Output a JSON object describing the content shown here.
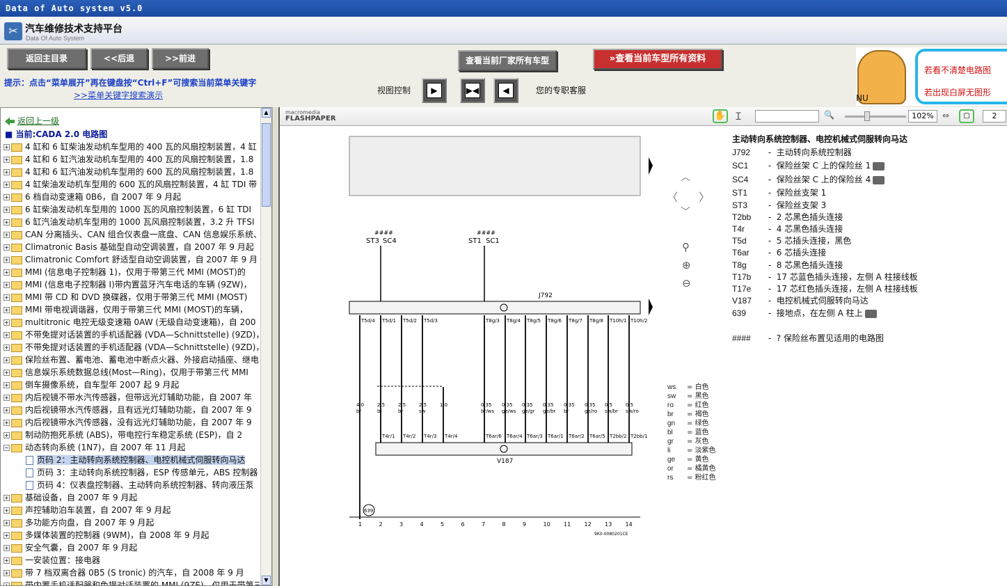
{
  "window": {
    "title": "Data of Auto system v5.0"
  },
  "app": {
    "title": "汽车维修技术支持平台",
    "subtitle": "Data Of Auto System"
  },
  "toolbar": {
    "home_label": "返回主目录",
    "back_label": "<<后退",
    "forward_label": ">>前进",
    "all_models_label": "查看当前厂家所有车型",
    "all_data_label": "查看当前车型所有资料",
    "tip": "提示：点击“菜单展开”再在键盘按“Ctrl+F”可搜索当前菜单关键字",
    "tip_link": ">>菜单关键字搜索演示",
    "view_control_label": "视图控制",
    "customer_service": "您的专职客服"
  },
  "ad": {
    "line1": "若看不清楚电路图",
    "line2": "若出现白屏无图形",
    "nu": "NU"
  },
  "tree": {
    "back_label": "返回上一级",
    "current_label": "当前:CADA 2.0 电路图",
    "items": [
      {
        "type": "folder",
        "label": "4 缸和 6 缸柴油发动机车型用的 400 瓦的风扇控制装置，4 缸"
      },
      {
        "type": "folder",
        "label": "4 缸和 6 缸汽油发动机车型用的 400 瓦的风扇控制装置，1.8"
      },
      {
        "type": "folder",
        "label": "4 缸和 6 缸汽油发动机车型用的 600 瓦的风扇控制装置，1.8"
      },
      {
        "type": "folder",
        "label": "4 缸柴油发动机车型用的 600 瓦的风扇控制装置，4 缸 TDI 带"
      },
      {
        "type": "folder",
        "label": "6 档自动变速箱 0B6，自 2007 年 9 月起"
      },
      {
        "type": "folder",
        "label": "6 缸柴油发动机车型用的 1000 瓦的风扇控制装置，6 缸 TDI"
      },
      {
        "type": "folder",
        "label": "6 缸汽油发动机车型用的 1000 瓦风扇控制装置，3.2 升 TFSI"
      },
      {
        "type": "folder",
        "label": "CAN 分离插头、CAN 组合仪表盘一底盘、CAN 信息娱乐系统、"
      },
      {
        "type": "folder",
        "label": "Climatronic Basis 基础型自动空调装置，自 2007 年 9 月起"
      },
      {
        "type": "folder",
        "label": "Climatronic Comfort 舒适型自动空调装置，自 2007 年 9 月"
      },
      {
        "type": "folder",
        "label": "MMI (信息电子控制器 1)，仅用于带第三代 MMI (MOST)的"
      },
      {
        "type": "folder",
        "label": "MMI (信息电子控制器 I)带内置蓝牙汽车电话的车辆 (9ZW)，"
      },
      {
        "type": "folder",
        "label": "MMI 带 CD 和 DVD 换碟器，仅用于带第三代 MMI (MOST)"
      },
      {
        "type": "folder",
        "label": "MMI 带电视调谐器，仅用于带第三代 MMI (MOST)的车辆，"
      },
      {
        "type": "folder",
        "label": "multitronic 电控无级变速箱 0AW (无级自动变速箱)，自 200"
      },
      {
        "type": "folder",
        "label": "不带免提对话装置的手机适配器 (VDA—Schnittstelle) (9ZD)，"
      },
      {
        "type": "folder",
        "label": "不带免提对话装置的手机适配器 (VDA—Schnittstelle) (9ZD)，"
      },
      {
        "type": "folder",
        "label": "保险丝布置、蓄电池、蓄电池中断点火器、外接启动插座、继电"
      },
      {
        "type": "folder",
        "label": "信息娱乐系统数据总线(Most—Ring)，仅用于带第三代 MMI"
      },
      {
        "type": "folder",
        "label": "倒车摄像系统，自车型年 2007 起 9 月起"
      },
      {
        "type": "folder",
        "label": "内后视镜不带水汽传感器，但带远光灯辅助功能，自 2007 年"
      },
      {
        "type": "folder",
        "label": "内后视镜带水汽传感器，且有远光灯辅助功能，自 2007 年 9"
      },
      {
        "type": "folder",
        "label": "内后视镜带水汽传感器，没有远光灯辅助功能，自 2007 年 9"
      },
      {
        "type": "folder",
        "label": "制动防抱死系统 (ABS)，带电控行车稳定系统 (ESP)，自 2"
      },
      {
        "type": "open",
        "label": "动态转向系统 (1N7)，自 2007 年 11 月起"
      },
      {
        "type": "page",
        "label": "页码 2：主动转向系统控制器、电控机械式伺服转向马达",
        "selected": true
      },
      {
        "type": "page",
        "label": "页码 3：主动转向系统控制器，ESP 传感单元，ABS 控制器"
      },
      {
        "type": "page",
        "label": "页码 4：仪表盘控制器、主动转向系统控制器、转向液压泵"
      },
      {
        "type": "folder",
        "label": "基础设备，自 2007 年 9 月起"
      },
      {
        "type": "folder",
        "label": "声控辅助泊车装置，自 2007 年 9 月起"
      },
      {
        "type": "folder",
        "label": "多功能方向盘，自 2007 年 9 月起"
      },
      {
        "type": "folder",
        "label": "多媒体装置的控制器 (9WM)，自 2008 年 9 月起"
      },
      {
        "type": "folder",
        "label": "安全气囊，自 2007 年 9 月起"
      },
      {
        "type": "folder",
        "label": "一安装位置：接电器"
      },
      {
        "type": "folder",
        "label": "带 7 档双离合器 0B5 (S tronic) 的汽车，自 2008 年 9 月"
      },
      {
        "type": "folder",
        "label": "带内置手机适配器和免提对话装置的 MMI (9ZE)，仅用于带第三"
      }
    ]
  },
  "viewer": {
    "brand_top": "macromedia",
    "brand_bottom": "FLASHPAPER",
    "zoom": "102%",
    "page": "2"
  },
  "legend": {
    "title": "主动转向系统控制器、电控机械式伺服转向马达",
    "items": [
      {
        "key": "J792",
        "desc": "主动转向系统控制器",
        "cam": false
      },
      {
        "key": "SC1",
        "desc": "保险丝架 C 上的保险丝 1",
        "cam": true
      },
      {
        "key": "SC4",
        "desc": "保险丝架 C 上的保险丝 4",
        "cam": true
      },
      {
        "key": "ST1",
        "desc": "保险丝支架 1",
        "cam": false
      },
      {
        "key": "ST3",
        "desc": "保险丝支架 3",
        "cam": false
      },
      {
        "key": "T2bb",
        "desc": "2 芯黑色插头连接",
        "cam": false
      },
      {
        "key": "T4r",
        "desc": "4 芯黑色插头连接",
        "cam": false
      },
      {
        "key": "T5d",
        "desc": "5 芯插头连接，黑色",
        "cam": false
      },
      {
        "key": "T6ar",
        "desc": "6 芯插头连接",
        "cam": false
      },
      {
        "key": "T8g",
        "desc": "8 芯黑色插头连接",
        "cam": false
      },
      {
        "key": "T17b",
        "desc": "17 芯蓝色插头连接，左侧 A 柱接线板",
        "cam": false
      },
      {
        "key": "T17e",
        "desc": "17 芯红色插头连接，左侧 A 柱接线板",
        "cam": false
      },
      {
        "key": "V187",
        "desc": "电控机械式伺服转向马达",
        "cam": false
      },
      {
        "key": "639",
        "desc": "接地点，在左侧 A 柱上",
        "cam": true
      },
      {
        "key": "####",
        "desc": "? 保险丝布置见适用的电路图",
        "cam": false
      }
    ]
  },
  "colors": [
    {
      "k": "ws",
      "v": "白色"
    },
    {
      "k": "sw",
      "v": "黑色"
    },
    {
      "k": "ro",
      "v": "红色"
    },
    {
      "k": "br",
      "v": "褐色"
    },
    {
      "k": "gn",
      "v": "绿色"
    },
    {
      "k": "bl",
      "v": "蓝色"
    },
    {
      "k": "gr",
      "v": "灰色"
    },
    {
      "k": "li",
      "v": "淡紫色"
    },
    {
      "k": "ge",
      "v": "黄色"
    },
    {
      "k": "or",
      "v": "橘黄色"
    },
    {
      "k": "rs",
      "v": "粉红色"
    }
  ],
  "diagram": {
    "fuse_labels": [
      "ST3",
      "SC4",
      "ST1",
      "SC1"
    ],
    "hash": "####",
    "j792_label": "J792",
    "v187_label": "V187",
    "ground_label": "639",
    "doc_code": "9K0-0080201CE",
    "conn_top": [
      "T5d/4",
      "T5d/1",
      "T5d/2",
      "T5d/3",
      "T8g/3",
      "T8g/4",
      "T8g/5",
      "T8g/6",
      "T8g/7",
      "T8g/8",
      "T10h/1",
      "T10h/2"
    ],
    "conn_bottom": [
      "T4r/1",
      "T4r/2",
      "T4r/3",
      "T4r/4",
      "T6ar/6",
      "T6ar/4",
      "T6ar/3",
      "T6ar/1",
      "T6ar/2",
      "T6ar/5",
      "T2bb/2",
      "T2bb/1"
    ],
    "wire_sizes": [
      "4.0",
      "2.5",
      "2.5",
      "2.5",
      "1.0",
      "0.35",
      "0.35",
      "0.35",
      "0.35",
      "0.35",
      "0.35",
      "0.5",
      "0.5"
    ],
    "wire_colors": [
      "br",
      "bl",
      "br",
      "sw",
      "",
      "br/ws",
      "ge/ws",
      "ge/gr",
      "ge/br",
      "br",
      "ge/ro",
      "sw/br",
      "sw/ro"
    ],
    "ruler": [
      "1",
      "2",
      "3",
      "4",
      "5",
      "6",
      "7",
      "8",
      "9",
      "10",
      "11",
      "12",
      "13",
      "14"
    ]
  }
}
